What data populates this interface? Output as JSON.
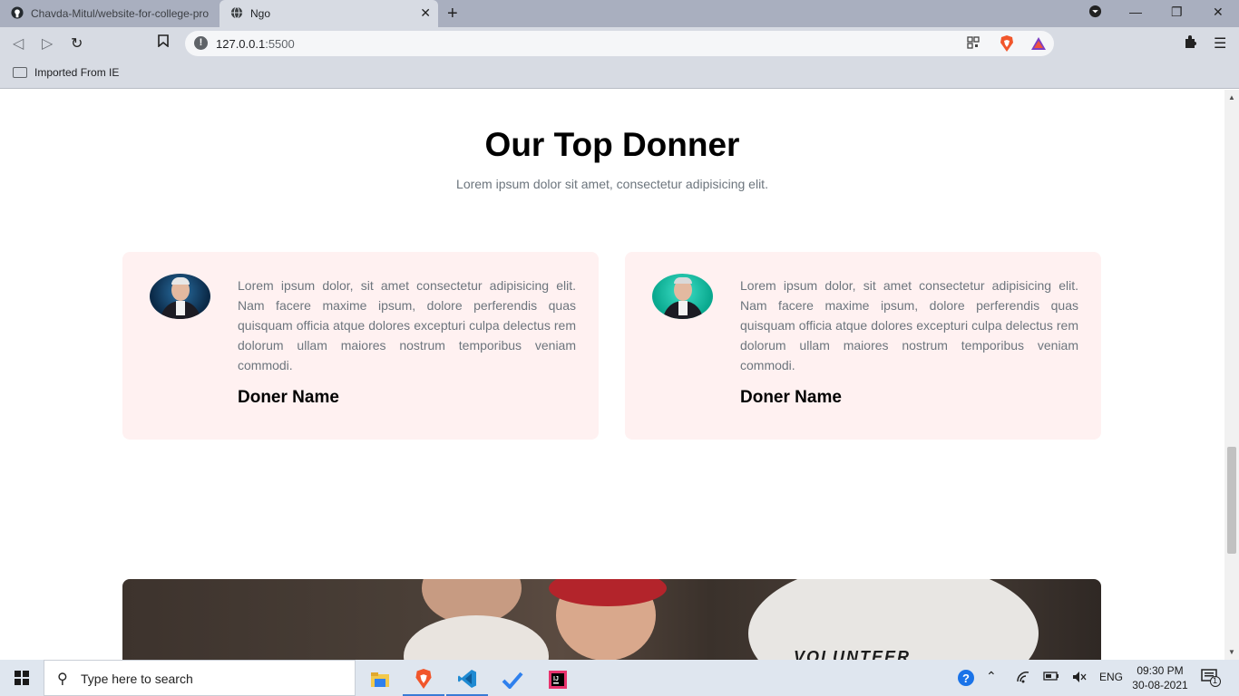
{
  "browser": {
    "tabs": [
      {
        "title": "Chavda-Mitul/website-for-college-pro",
        "icon": "github-icon"
      },
      {
        "title": "Ngo",
        "icon": "globe-icon",
        "active": true
      }
    ],
    "url_host": "127.0.0.1",
    "url_port": ":5500",
    "bookmarks": [
      {
        "label": "Imported From IE",
        "icon": "folder-icon"
      }
    ]
  },
  "page": {
    "section": {
      "title": "Our Top Donner",
      "subtitle": "Lorem ipsum dolor sit amet, consectetur adipisicing elit."
    },
    "donors": [
      {
        "text": "Lorem ipsum dolor, sit amet consectetur adipisicing elit. Nam facere maxime ipsum, dolore perferendis quas quisquam officia atque dolores excepturi culpa delectus rem dolorum ullam maiores nostrum temporibus veniam commodi.",
        "name": "Doner Name"
      },
      {
        "text": "Lorem ipsum dolor, sit amet consectetur adipisicing elit. Nam facere maxime ipsum, dolore perferendis quas quisquam officia atque dolores excepturi culpa delectus rem dolorum ullam maiores nostrum temporibus veniam commodi.",
        "name": "Doner Name"
      }
    ],
    "banner_shirt_text": "VOLUNTEER"
  },
  "taskbar": {
    "search_placeholder": "Type here to search",
    "language": "ENG",
    "time": "09:30 PM",
    "date": "30-08-2021",
    "notification_count": "1"
  },
  "colors": {
    "card_bg": "#fff1f1",
    "muted_text": "#6c757d",
    "chrome_bg": "#d7dbe3"
  }
}
